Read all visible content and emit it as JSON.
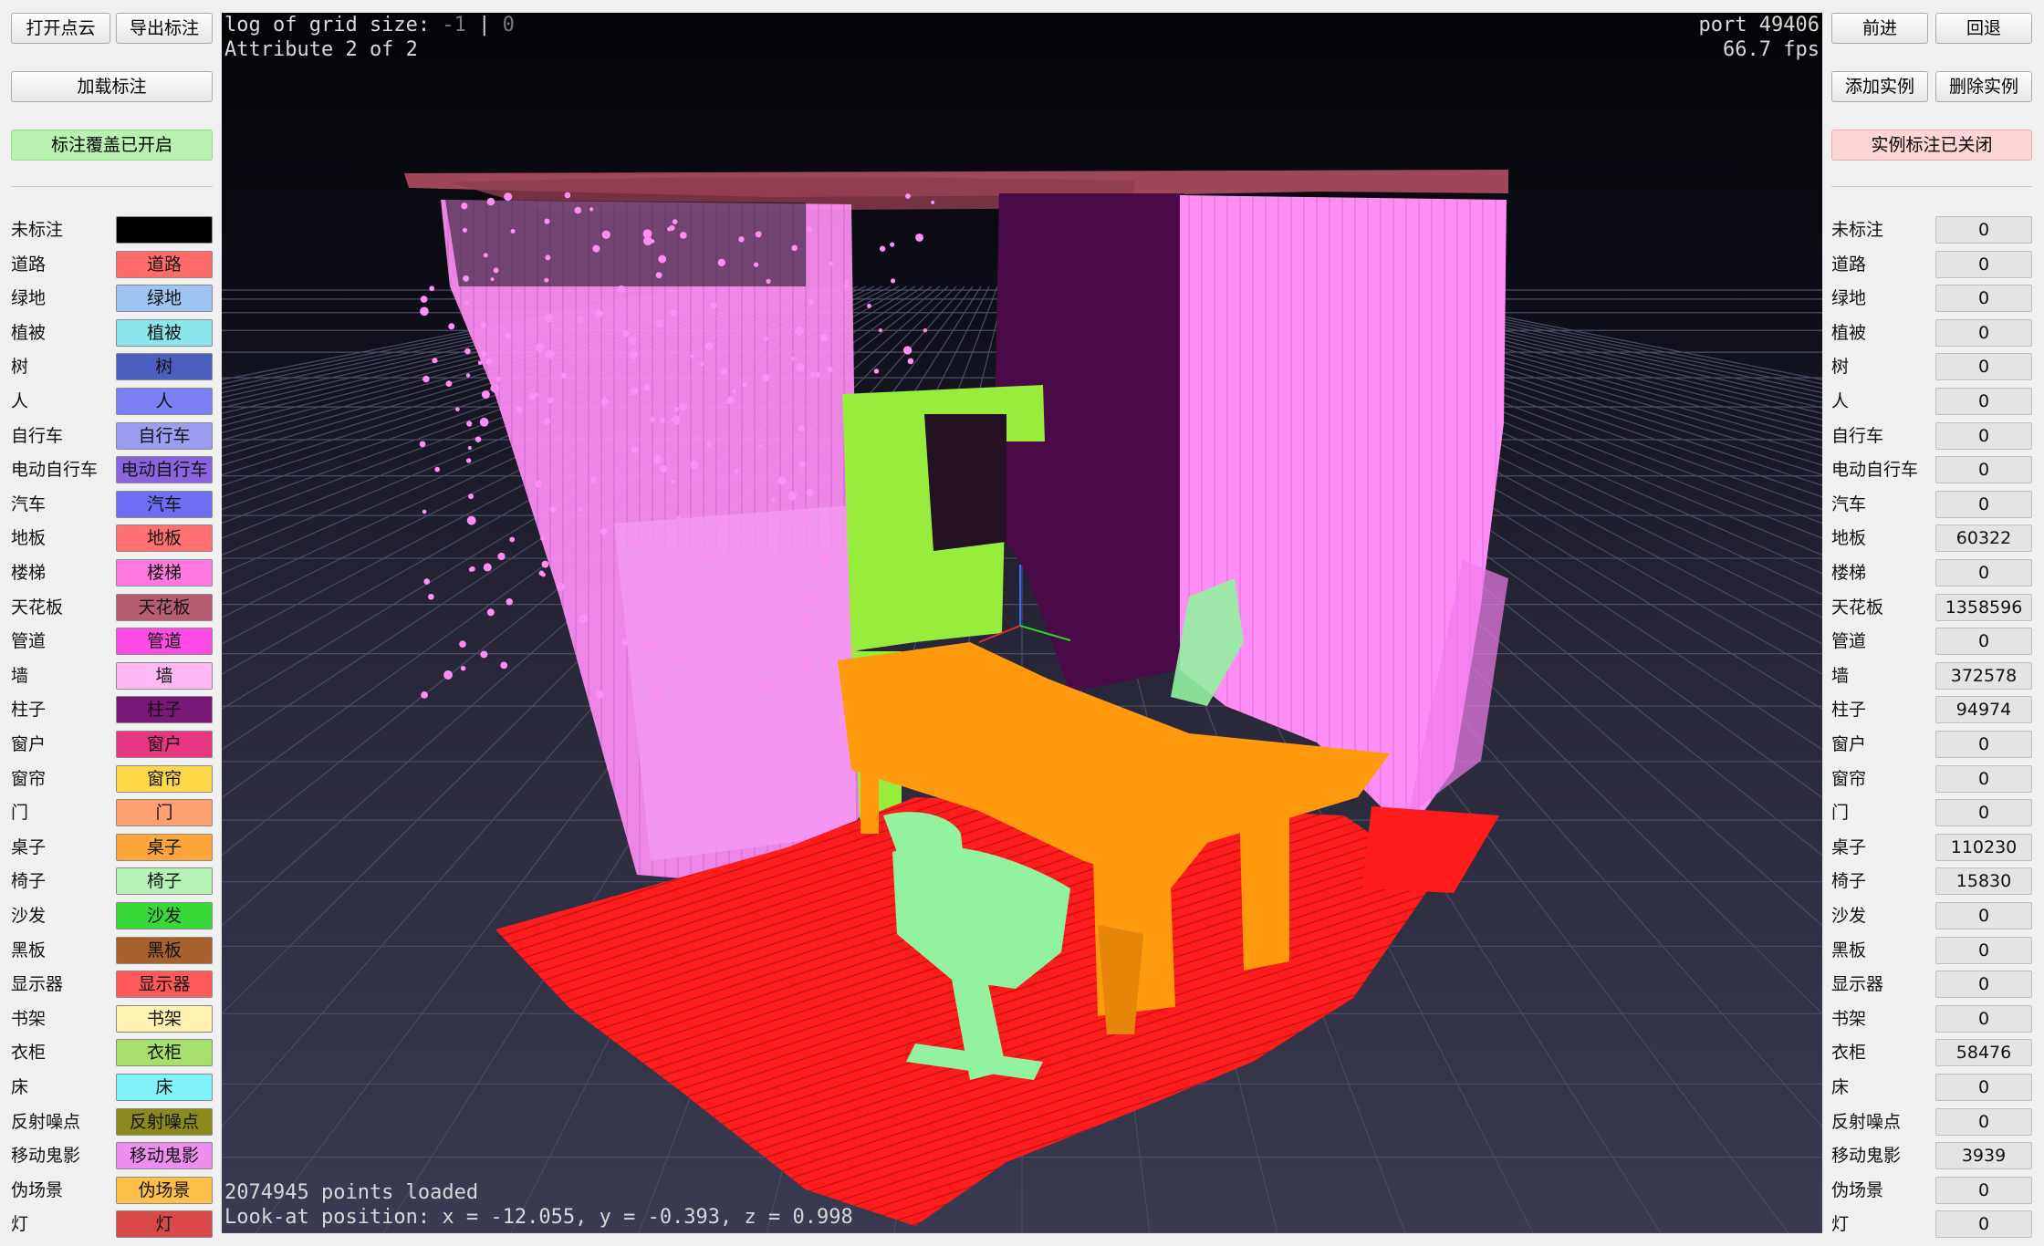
{
  "left_panel": {
    "open_cloud": "打开点云",
    "export_labels": "导出标注",
    "load_labels": "加载标注",
    "overlay_toggle": "标注覆盖已开启"
  },
  "right_panel": {
    "forward": "前进",
    "back": "回退",
    "add_instance": "添加实例",
    "delete_instance": "删除实例",
    "instance_toggle": "实例标注已关闭"
  },
  "categories": [
    {
      "name": "未标注",
      "color": "#000000",
      "text": "#000000",
      "count": "0"
    },
    {
      "name": "道路",
      "color": "#ff6b6b",
      "text": "#111111",
      "count": "0"
    },
    {
      "name": "绿地",
      "color": "#9ec5f2",
      "text": "#111111",
      "count": "0"
    },
    {
      "name": "植被",
      "color": "#8ae6ec",
      "text": "#111111",
      "count": "0"
    },
    {
      "name": "树",
      "color": "#4b5fbf",
      "text": "#111111",
      "count": "0"
    },
    {
      "name": "人",
      "color": "#7c80f2",
      "text": "#111111",
      "count": "0"
    },
    {
      "name": "自行车",
      "color": "#9c9cf0",
      "text": "#111111",
      "count": "0"
    },
    {
      "name": "电动自行车",
      "color": "#8a64e0",
      "text": "#111111",
      "count": "0"
    },
    {
      "name": "汽车",
      "color": "#6e6ef5",
      "text": "#111111",
      "count": "0"
    },
    {
      "name": "地板",
      "color": "#ff7070",
      "text": "#111111",
      "count": "60322"
    },
    {
      "name": "楼梯",
      "color": "#ff7ae0",
      "text": "#111111",
      "count": "0"
    },
    {
      "name": "天花板",
      "color": "#b75d73",
      "text": "#111111",
      "count": "1358596"
    },
    {
      "name": "管道",
      "color": "#ff4be6",
      "text": "#111111",
      "count": "0"
    },
    {
      "name": "墙",
      "color": "#ffb8f2",
      "text": "#111111",
      "count": "372578"
    },
    {
      "name": "柱子",
      "color": "#7a1878",
      "text": "#111111",
      "count": "94974"
    },
    {
      "name": "窗户",
      "color": "#e8357f",
      "text": "#111111",
      "count": "0"
    },
    {
      "name": "窗帘",
      "color": "#ffd84a",
      "text": "#111111",
      "count": "0"
    },
    {
      "name": "门",
      "color": "#ffa070",
      "text": "#111111",
      "count": "0"
    },
    {
      "name": "桌子",
      "color": "#ffa63a",
      "text": "#111111",
      "count": "110230"
    },
    {
      "name": "椅子",
      "color": "#b6f2b6",
      "text": "#111111",
      "count": "15830"
    },
    {
      "name": "沙发",
      "color": "#38d838",
      "text": "#111111",
      "count": "0"
    },
    {
      "name": "黑板",
      "color": "#a8602c",
      "text": "#111111",
      "count": "0"
    },
    {
      "name": "显示器",
      "color": "#ff5a5a",
      "text": "#111111",
      "count": "0"
    },
    {
      "name": "书架",
      "color": "#fff2b0",
      "text": "#111111",
      "count": "0"
    },
    {
      "name": "衣柜",
      "color": "#a6e06a",
      "text": "#111111",
      "count": "58476"
    },
    {
      "name": "床",
      "color": "#7ef4f8",
      "text": "#111111",
      "count": "0"
    },
    {
      "name": "反射噪点",
      "color": "#8a8a1e",
      "text": "#111111",
      "count": "0"
    },
    {
      "name": "移动鬼影",
      "color": "#f08ef0",
      "text": "#111111",
      "count": "3939"
    },
    {
      "name": "伪场景",
      "color": "#ffc04a",
      "text": "#111111",
      "count": "0"
    },
    {
      "name": "灯",
      "color": "#d84a4a",
      "text": "#111111",
      "count": "0"
    }
  ],
  "viewport": {
    "grid_label": "log of grid size:",
    "grid_values": "-1",
    "grid_sep": " | ",
    "grid_value2": "0",
    "attribute": "Attribute 2 of 2",
    "port": "port 49406",
    "fps": "66.7 fps",
    "points_loaded": "2074945 points loaded",
    "look_at": "Look-at position: x = -12.055, y = -0.393, z = 0.998"
  },
  "colors": {
    "ceiling": "#a0465a",
    "wall": "#ff8ef4",
    "column": "#4a0a48",
    "wardrobe": "#98ec3c",
    "table": "#ff9a0e",
    "chair": "#92f2a0",
    "floor": "#ff1c1c"
  }
}
